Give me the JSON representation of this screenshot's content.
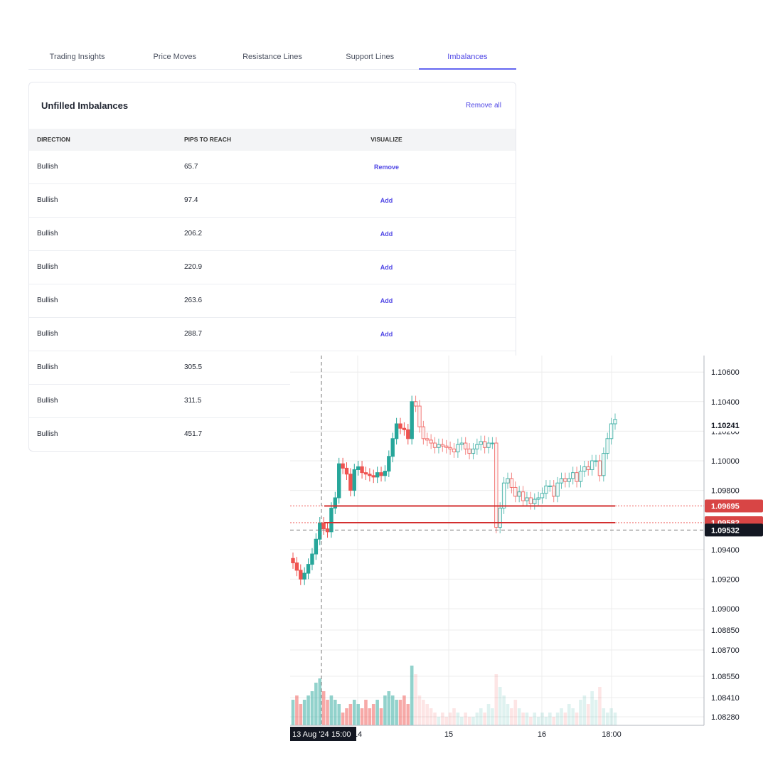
{
  "tabs": [
    {
      "label": "Trading Insights"
    },
    {
      "label": "Price Moves"
    },
    {
      "label": "Resistance Lines"
    },
    {
      "label": "Support Lines"
    },
    {
      "label": "Imbalances",
      "active": true
    }
  ],
  "card": {
    "title": "Unfilled Imbalances",
    "remove_all": "Remove all",
    "columns": [
      "DIRECTION",
      "PIPS TO REACH",
      "VISUALIZE"
    ],
    "rows": [
      {
        "direction": "Bullish",
        "pips": "65.7",
        "action": "Remove"
      },
      {
        "direction": "Bullish",
        "pips": "97.4",
        "action": "Add"
      },
      {
        "direction": "Bullish",
        "pips": "206.2",
        "action": "Add"
      },
      {
        "direction": "Bullish",
        "pips": "220.9",
        "action": "Add"
      },
      {
        "direction": "Bullish",
        "pips": "263.6",
        "action": "Add"
      },
      {
        "direction": "Bullish",
        "pips": "288.7",
        "action": "Add"
      },
      {
        "direction": "Bullish",
        "pips": "305.5",
        "action": ""
      },
      {
        "direction": "Bullish",
        "pips": "311.5",
        "action": ""
      },
      {
        "direction": "Bullish",
        "pips": "451.7",
        "action": ""
      }
    ]
  },
  "chart_data": {
    "type": "candlestick",
    "price_ticks": [
      "1.10600",
      "1.10400",
      "1.10200",
      "1.10000",
      "1.09800",
      "1.09400",
      "1.09200",
      "1.09000",
      "1.08850",
      "1.08700",
      "1.08550",
      "1.08410",
      "1.08280"
    ],
    "time_ticks": [
      "14",
      "15",
      "16",
      "18:00"
    ],
    "crosshair": {
      "time": "13 Aug '24",
      "clock": "15:00",
      "price": "1.09532"
    },
    "current_price": "1.10241",
    "imbalance_levels": [
      {
        "price": "1.09695"
      },
      {
        "price": "1.09582"
      }
    ],
    "colors": {
      "up": "#26a69a",
      "down": "#ef5350",
      "level": "#d32f2f",
      "crosshair_label": "#131722"
    },
    "closes": [
      1.0931,
      1.0926,
      1.092,
      1.0924,
      1.093,
      1.0937,
      1.0947,
      1.0958,
      1.0954,
      1.0952,
      1.0968,
      1.0975,
      1.0998,
      1.0995,
      1.0991,
      1.098,
      1.0994,
      1.0996,
      1.0992,
      1.0991,
      1.099,
      1.0989,
      1.0992,
      1.099,
      1.0993,
      1.1003,
      1.1015,
      1.1025,
      1.1022,
      1.1021,
      1.1015,
      1.104,
      1.1037,
      1.1023,
      1.1015,
      1.1014,
      1.1012,
      1.1009,
      1.1011,
      1.101,
      1.1009,
      1.1008,
      1.1006,
      1.1011,
      1.1012,
      1.1008,
      1.1005,
      1.1008,
      1.1011,
      1.1013,
      1.1009,
      1.1012,
      1.1012,
      1.0955,
      1.0968,
      1.0985,
      1.0988,
      1.0982,
      1.0976,
      1.0979,
      1.0973,
      1.0975,
      1.0971,
      1.0974,
      1.0975,
      1.0978,
      1.0983,
      1.0983,
      1.0976,
      1.0985,
      1.0988,
      1.0986,
      1.0988,
      1.0992,
      1.0986,
      1.0993,
      1.0996,
      1.0994,
      1.1,
      1.1,
      1.099,
      1.1005,
      1.1015,
      1.1025,
      1.1028
    ],
    "volumes": [
      6,
      7,
      5,
      6,
      7,
      8,
      10,
      11,
      8,
      6,
      7,
      6,
      5,
      3,
      4,
      5,
      6,
      5,
      4,
      6,
      4,
      5,
      6,
      4,
      7,
      8,
      7,
      6,
      6,
      7,
      5,
      14,
      12,
      7,
      6,
      5,
      4,
      3,
      2,
      3,
      2,
      3,
      4,
      3,
      2,
      3,
      2,
      2,
      3,
      4,
      3,
      5,
      4,
      12,
      9,
      7,
      5,
      4,
      6,
      4,
      3,
      3,
      2,
      3,
      2,
      3,
      2,
      3,
      2,
      3,
      4,
      3,
      5,
      4,
      3,
      6,
      7,
      5,
      8,
      6,
      9,
      4,
      3,
      4,
      3
    ]
  }
}
